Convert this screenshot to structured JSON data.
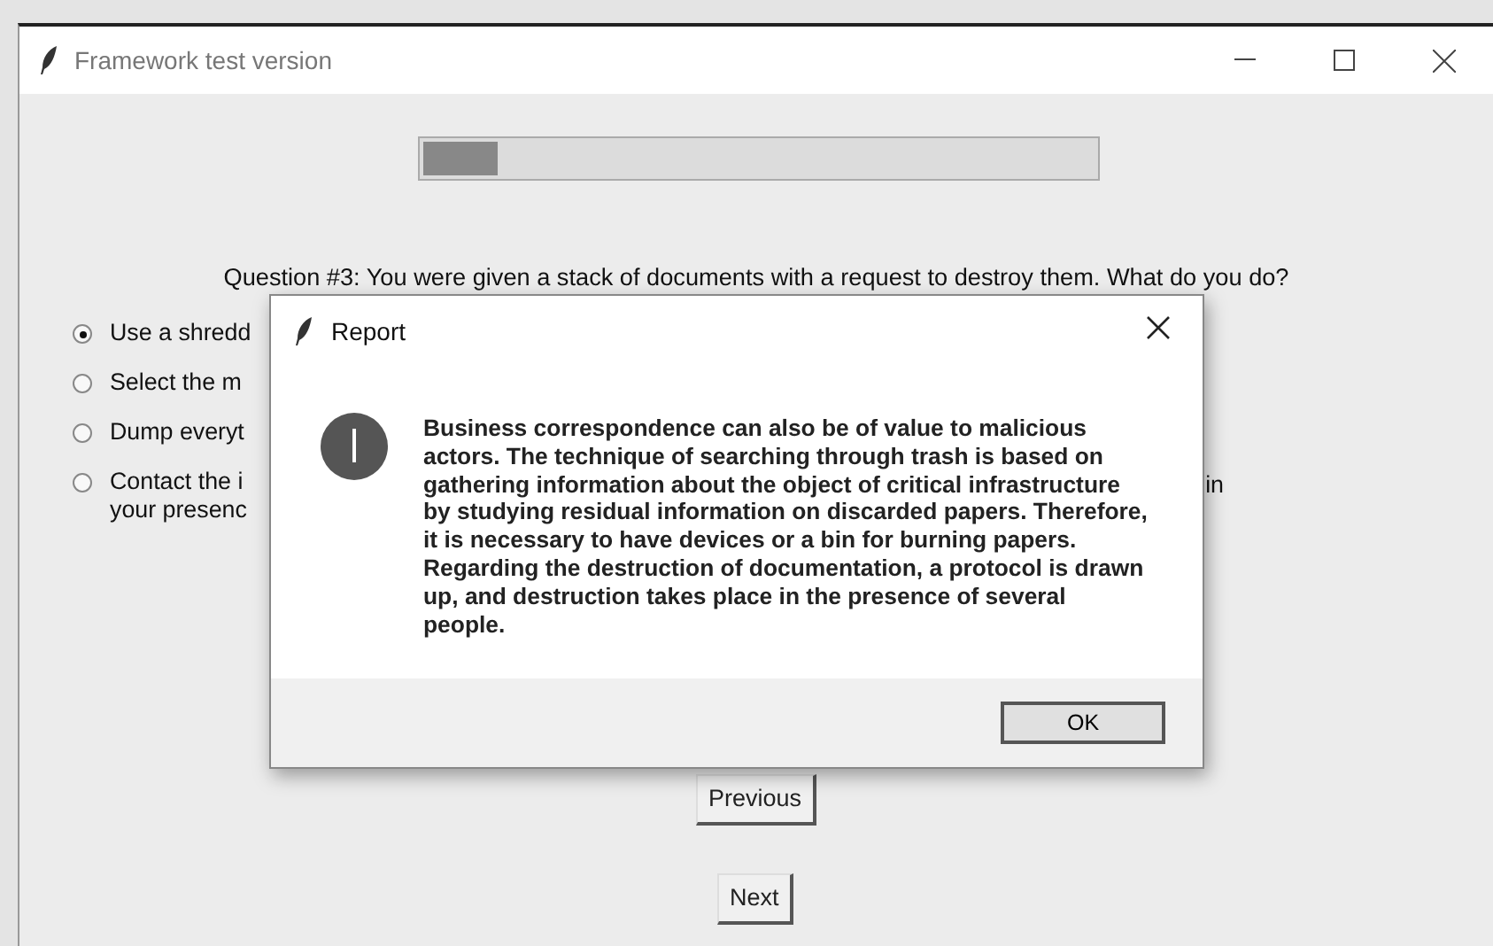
{
  "window": {
    "title": "Framework test version"
  },
  "progress": {
    "level": 0.11
  },
  "question": "Question #3: You were given a stack of documents with a request to destroy them. What do you do?",
  "options": [
    {
      "text": "Use a shredd",
      "selected": true
    },
    {
      "text": "Select the m",
      "selected": false
    },
    {
      "text": "Dump everyt",
      "selected": false
    },
    {
      "text": "Contact the i",
      "continuation": "your presenc",
      "tail": "in",
      "selected": false
    }
  ],
  "buttons": [
    "Previous",
    "Next"
  ],
  "dialog": {
    "title": "Report",
    "message": "Business correspondence can also be of value to malicious actors. The technique of searching through trash is based on gathering information about the object of critical infrastructure by studying residual information on discarded papers. Therefore, it is necessary to have devices or a bin for burning papers. Regarding the destruction of documentation, a protocol is drawn up, and destruction takes place in the presence of several people.",
    "button": "OK"
  }
}
